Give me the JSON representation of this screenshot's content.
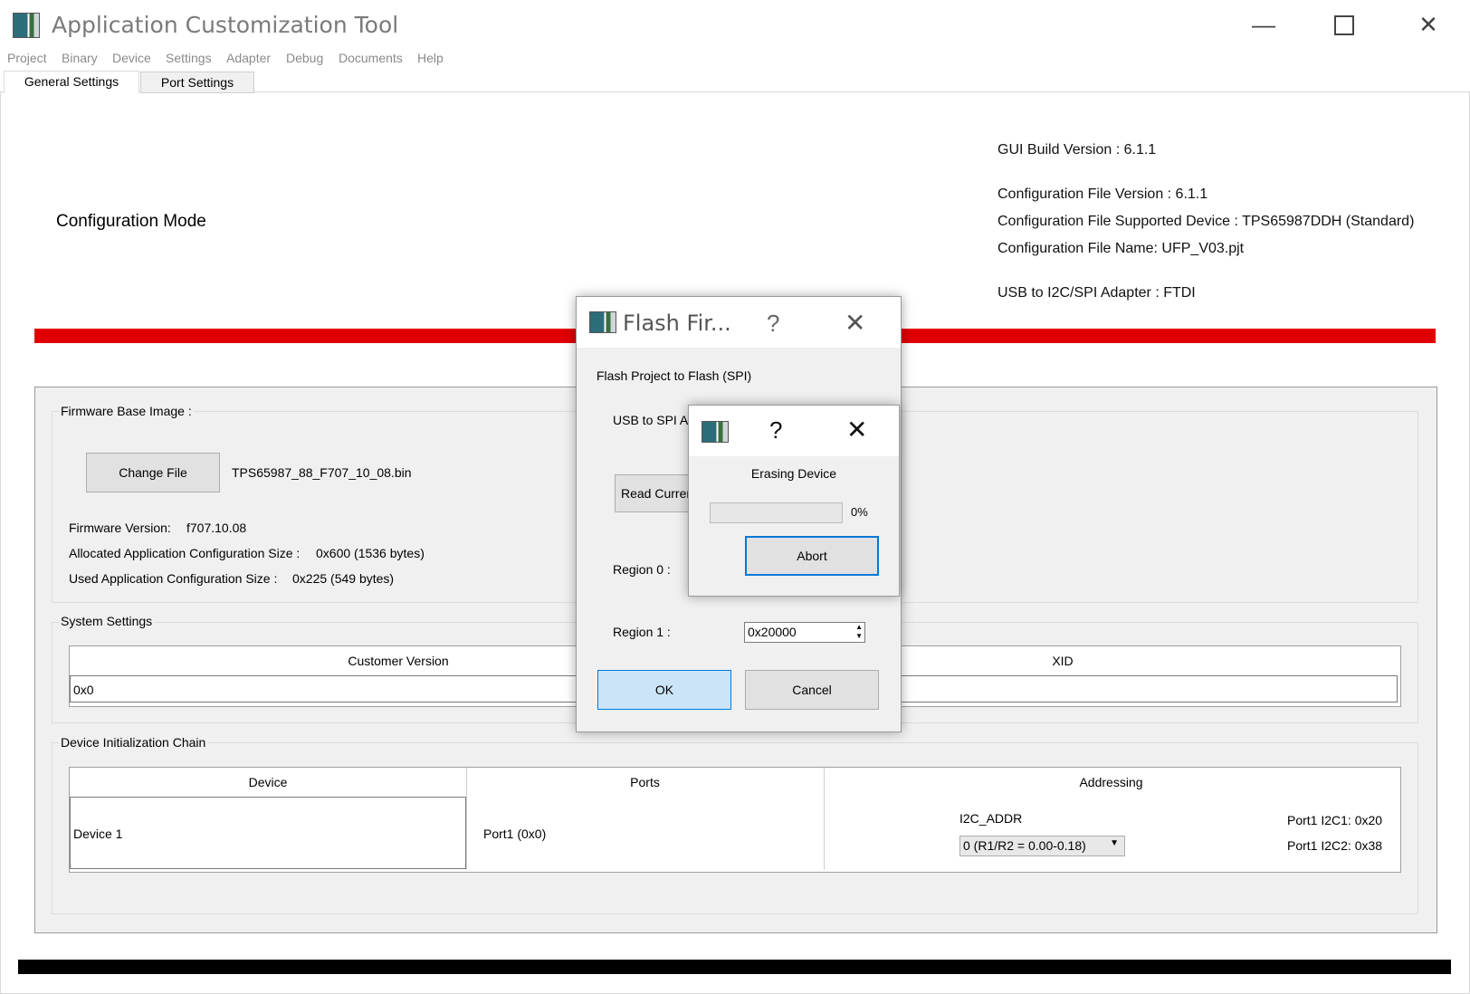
{
  "window": {
    "title": "Application Customization Tool",
    "minimize_glyph": "—",
    "maximize_glyph": "☐",
    "close_glyph": "✕"
  },
  "menu": [
    "Project",
    "Binary",
    "Device",
    "Settings",
    "Adapter",
    "Debug",
    "Documents",
    "Help"
  ],
  "tabs": [
    "General Settings",
    "Port Settings"
  ],
  "header": {
    "mode": "Configuration Mode",
    "gui_build": "GUI Build Version : 6.1.1",
    "config_version": "Configuration File Version : 6.1.1",
    "supported_device": "Configuration File Supported Device : TPS65987DDH (Standard)",
    "config_name": "Configuration File Name: UFP_V03.pjt",
    "adapter": "USB to I2C/SPI Adapter : FTDI"
  },
  "firmware": {
    "group_label": "Firmware Base Image :",
    "change_file_label": "Change File",
    "file_name": "TPS65987_88_F707_10_08.bin",
    "version_label": "Firmware Version:",
    "version_value": "f707.10.08",
    "allocated_label": "Allocated Application Configuration Size :",
    "allocated_value": "0x600 (1536 bytes)",
    "used_label": "Used Application Configuration Size :",
    "used_value": "0x225 (549 bytes)"
  },
  "system": {
    "group_label": "System Settings",
    "col_customer": "Customer Version",
    "col_xid": "XID",
    "customer_value": "0x0",
    "xid_value": ""
  },
  "chain": {
    "group_label": "Device Initialization Chain",
    "col_device": "Device",
    "col_ports": "Ports",
    "col_addressing": "Addressing",
    "device_value": "Device 1",
    "ports_value": "Port1 (0x0)",
    "i2c_addr_label": "I2C_ADDR",
    "i2c_addr_select": "0 (R1/R2 = 0.00-0.18)",
    "port_i2c1": "Port1 I2C1: 0x20",
    "port_i2c2": "Port1 I2C2: 0x38"
  },
  "flash_dialog": {
    "title": "Flash Fir...",
    "help_glyph": "?",
    "close_glyph": "✕",
    "heading": "Flash Project to Flash (SPI)",
    "usb_label": "USB to SPI Ac",
    "read_current_label": "Read Curren",
    "region0_label": "Region 0 :",
    "region1_label": "Region 1 :",
    "region1_value": "0x20000",
    "ok_label": "OK",
    "cancel_label": "Cancel"
  },
  "erase_dialog": {
    "help_glyph": "?",
    "close_glyph": "✕",
    "message": "Erasing Device",
    "progress": 0,
    "progress_text": "0%",
    "abort_label": "Abort"
  },
  "colors": {
    "accent_red": "#e00000",
    "primary_button": "#cce4f7",
    "primary_border": "#0078d7"
  }
}
